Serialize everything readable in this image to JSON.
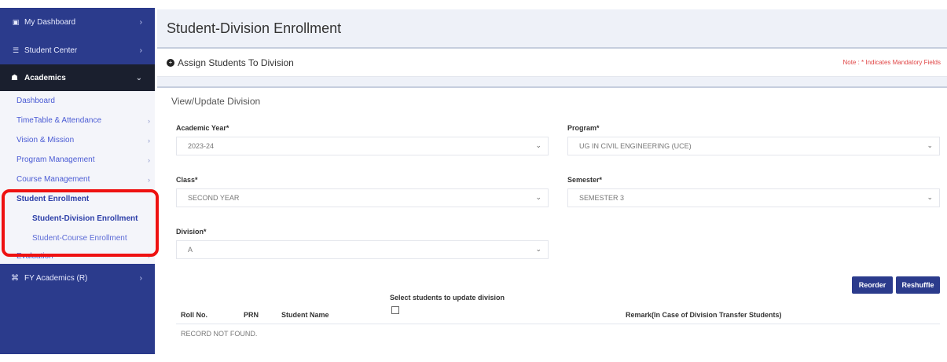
{
  "sidebar": {
    "top_items": [
      {
        "label": "My Dashboard",
        "icon": "dashboard-icon"
      },
      {
        "label": "Student Center",
        "icon": "student-icon"
      }
    ],
    "academics_label": "Academics",
    "sub_items": [
      {
        "label": "Dashboard",
        "has_chevron": false
      },
      {
        "label": "TimeTable & Attendance",
        "has_chevron": true
      },
      {
        "label": "Vision & Mission",
        "has_chevron": true
      },
      {
        "label": "Program Management",
        "has_chevron": true
      },
      {
        "label": "Course Management",
        "has_chevron": true
      }
    ],
    "student_enrollment_label": "Student Enrollment",
    "enrollment_items": [
      {
        "label": "Student-Division Enrollment",
        "active": true
      },
      {
        "label": "Student-Course Enrollment",
        "active": false
      }
    ],
    "evaluation_label": "Evaluation",
    "fy_label": "FY Academics (R)"
  },
  "page": {
    "title": "Student-Division Enrollment",
    "section_title": "Assign Students To Division",
    "note": "Note : * Indicates Mandatory Fields",
    "panel_title": "View/Update Division"
  },
  "form": {
    "academic_year_label": "Academic Year*",
    "academic_year_value": "2023-24",
    "program_label": "Program*",
    "program_value": "UG IN CIVIL ENGINEERING (UCE)",
    "class_label": "Class*",
    "class_value": "SECOND YEAR",
    "semester_label": "Semester*",
    "semester_value": "SEMESTER 3",
    "division_label": "Division*",
    "division_value": "A"
  },
  "buttons": {
    "reorder": "Reorder",
    "reshuffle": "Reshuffle"
  },
  "table": {
    "select_note": "Select students to update division",
    "headers": [
      "Roll No.",
      "PRN",
      "Student Name",
      "Remark(In Case of Division Transfer Students)"
    ],
    "empty_text": "RECORD NOT FOUND."
  },
  "colors": {
    "sidebar_blue": "#2b3b8c",
    "academics_dark": "#1a1f2e",
    "highlight_red": "#ee1111",
    "note_red": "#e04646"
  }
}
